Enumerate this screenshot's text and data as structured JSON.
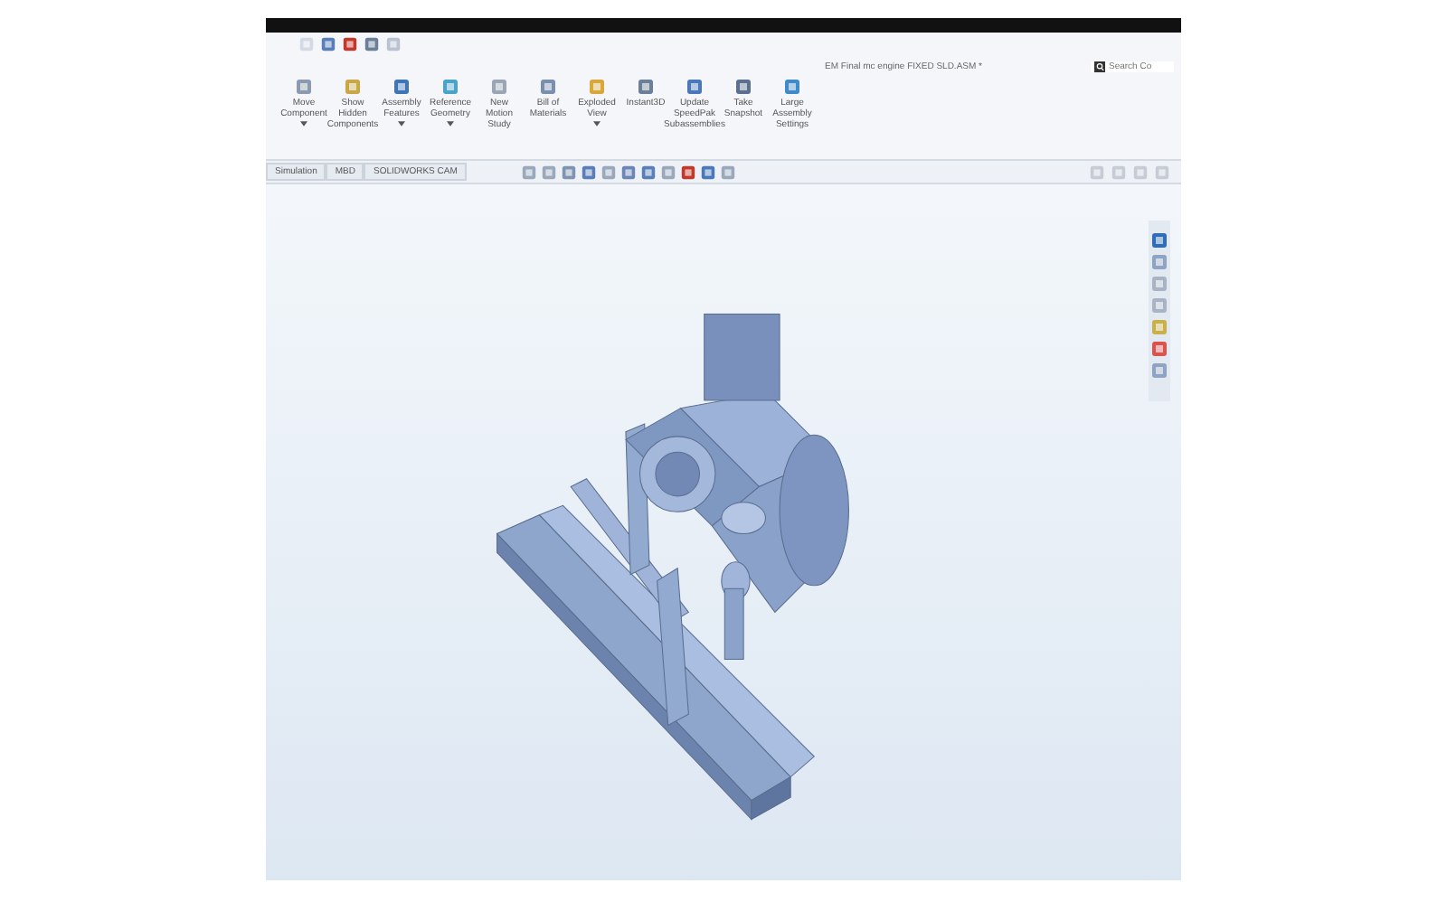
{
  "window": {
    "title": "EM Final mc engine FIXED SLD.ASM *"
  },
  "search": {
    "placeholder": "Search Co"
  },
  "ribbon": [
    {
      "label": "Move Component",
      "dropdown": true
    },
    {
      "label": "Show Hidden Components",
      "dropdown": false
    },
    {
      "label": "Assembly Features",
      "dropdown": true
    },
    {
      "label": "Reference Geometry",
      "dropdown": true
    },
    {
      "label": "New Motion Study",
      "dropdown": false
    },
    {
      "label": "Bill of Materials",
      "dropdown": false
    },
    {
      "label": "Exploded View",
      "dropdown": true
    },
    {
      "label": "Instant3D",
      "dropdown": false
    },
    {
      "label": "Update SpeedPak Subassemblies",
      "dropdown": false
    },
    {
      "label": "Take Snapshot",
      "dropdown": false
    },
    {
      "label": "Large Assembly Settings",
      "dropdown": false
    }
  ],
  "tabs": [
    {
      "label": "Simulation",
      "selected": false
    },
    {
      "label": "MBD",
      "selected": false
    },
    {
      "label": "SOLIDWORKS CAM",
      "selected": false
    }
  ]
}
